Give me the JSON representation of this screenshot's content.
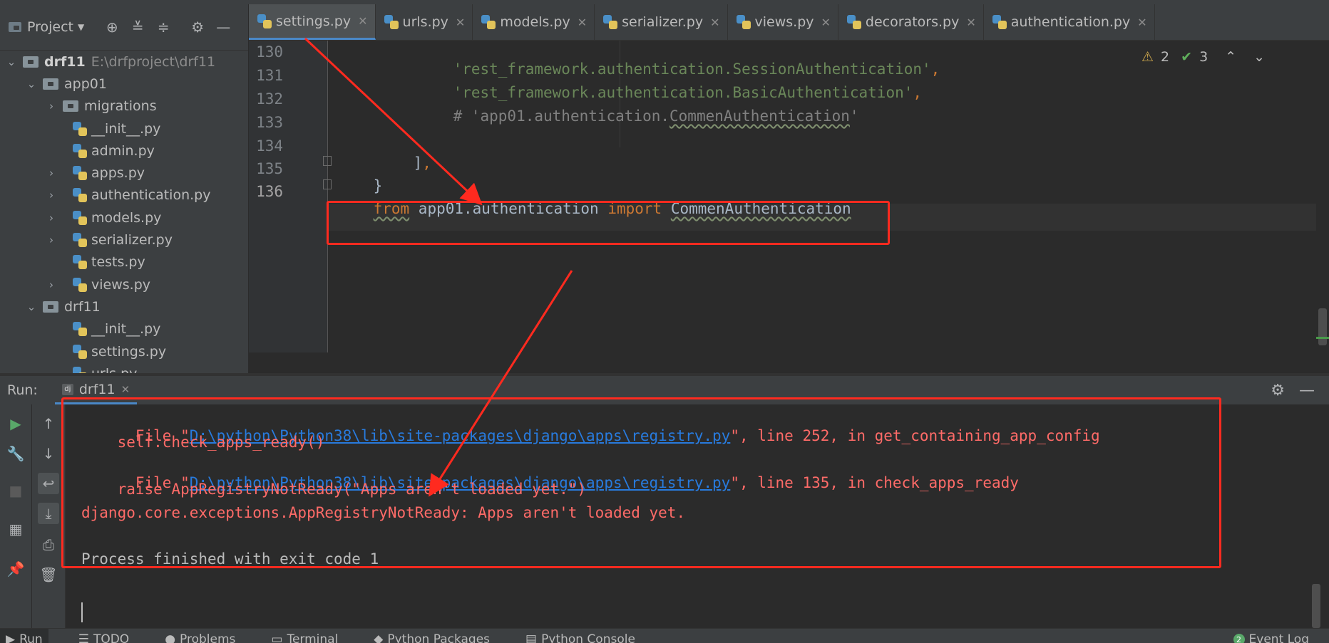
{
  "project": {
    "title": "Project",
    "root": {
      "name": "drf11",
      "path": "E:\\drfproject\\drf11"
    },
    "items": [
      {
        "label": "app01",
        "kind": "folder",
        "expanded": true
      },
      {
        "label": "migrations",
        "kind": "folder"
      },
      {
        "label": "__init__.py",
        "kind": "py"
      },
      {
        "label": "admin.py",
        "kind": "py"
      },
      {
        "label": "apps.py",
        "kind": "py"
      },
      {
        "label": "authentication.py",
        "kind": "py"
      },
      {
        "label": "models.py",
        "kind": "py"
      },
      {
        "label": "serializer.py",
        "kind": "py"
      },
      {
        "label": "tests.py",
        "kind": "py"
      },
      {
        "label": "views.py",
        "kind": "py"
      },
      {
        "label": "drf11",
        "kind": "folder",
        "expanded": true
      },
      {
        "label": "__init__.py",
        "kind": "py"
      },
      {
        "label": "settings.py",
        "kind": "py"
      },
      {
        "label": "urls.py",
        "kind": "py"
      }
    ]
  },
  "tabs": [
    {
      "label": "settings.py",
      "active": true
    },
    {
      "label": "urls.py"
    },
    {
      "label": "models.py"
    },
    {
      "label": "serializer.py"
    },
    {
      "label": "views.py"
    },
    {
      "label": "decorators.py"
    },
    {
      "label": "authentication.py"
    }
  ],
  "editor": {
    "inspections": {
      "warnings": "2",
      "ok": "3"
    },
    "lines": [
      {
        "num": "130",
        "str": "'rest_framework.authentication.SessionAuthentication'",
        "tail": ","
      },
      {
        "num": "131",
        "str": "'rest_framework.authentication.BasicAuthentication'",
        "tail": ","
      },
      {
        "num": "132",
        "comment_pre": "# 'app01.authentication.",
        "comment_wavy": "CommenAuthentication",
        "comment_post": "'"
      },
      {
        "num": "133"
      },
      {
        "num": "134",
        "text": "],",
        "comma": ","
      },
      {
        "num": "135",
        "text": "}"
      },
      {
        "num": "136",
        "kw_from": "from",
        "module": " app01.authentication ",
        "kw_import": "import",
        "name": "CommenAuthentication"
      }
    ]
  },
  "run": {
    "label": "Run:",
    "tab": "drf11",
    "tab_icon": "dj",
    "console": [
      {
        "pre": "  File \"",
        "link": "D:\\python\\Python38\\lib\\site-packages\\django\\apps\\registry.py",
        "post": "\", line 252, in get_containing_app_config"
      },
      {
        "text": "    self.check_apps_ready()"
      },
      {
        "pre": "  File \"",
        "link": "D:\\python\\Python38\\lib\\site-packages\\django\\apps\\registry.py",
        "post": "\", line 135, in check_apps_ready"
      },
      {
        "text": "    raise AppRegistryNotReady(\"Apps aren't loaded yet.\")"
      },
      {
        "text": "django.core.exceptions.AppRegistryNotReady: Apps aren't loaded yet."
      },
      {
        "text": "Process finished with exit code 1"
      }
    ]
  },
  "bottom_bar": {
    "items": [
      "Run",
      "TODO",
      "Problems",
      "Terminal",
      "Python Packages",
      "Python Console"
    ],
    "event_log": "Event Log",
    "event_count": "2"
  },
  "colors": {
    "annotation": "#ff2a1f",
    "accent": "#4a88c7",
    "error": "#ff6b68",
    "link": "#287bde"
  }
}
